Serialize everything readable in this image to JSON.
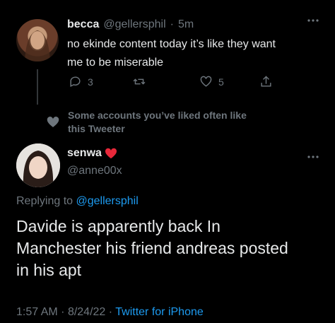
{
  "first_tweet": {
    "author_name": "becca",
    "handle": "@gellersphil",
    "separator": "·",
    "time": "5m",
    "text_line1": "no ekinde content today it’s like they want",
    "text_line2": "me to be miserable",
    "actions": {
      "reply_count": "3",
      "retweet_count": "",
      "like_count": "5"
    },
    "more_icon": "more-horizontal-icon"
  },
  "social_context": {
    "icon": "heart-icon",
    "line1": "Some accounts you’ve liked often like",
    "line2": "this Tweeter"
  },
  "main_tweet": {
    "author_name": "senwa",
    "author_emoji": "❤️",
    "handle": "@anne00x",
    "replying_prefix": "Replying to",
    "replying_to": "@gellersphil",
    "text_line1": "Davide is apparently back In",
    "text_line2": "Manchester his friend andreas posted",
    "text_line3": "in his apt",
    "meta_time": "1:57 AM",
    "meta_sep1": "·",
    "meta_date": "8/24/22",
    "meta_sep2": "·",
    "meta_source": "Twitter for iPhone"
  },
  "colors": {
    "background": "#000000",
    "text": "#e7e9ea",
    "muted": "#6e767d",
    "link": "#1d9bf0",
    "heart": "#f91880"
  }
}
